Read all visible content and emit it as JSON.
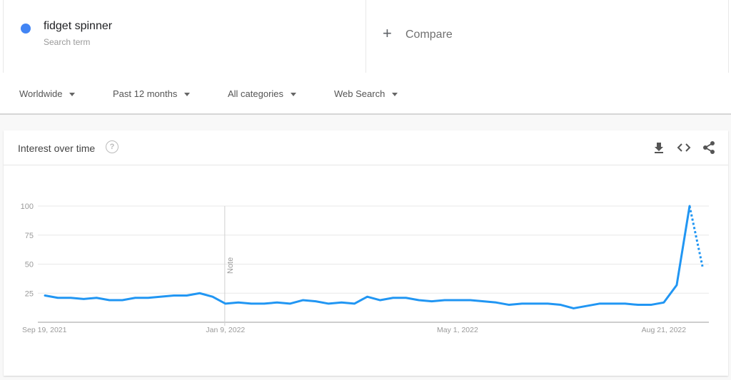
{
  "search_term": {
    "label": "fidget spinner",
    "sublabel": "Search term",
    "color": "#4285f4"
  },
  "compare": {
    "label": "Compare",
    "icon": "plus-icon"
  },
  "filters": [
    {
      "label": "Worldwide"
    },
    {
      "label": "Past 12 months"
    },
    {
      "label": "All categories"
    },
    {
      "label": "Web Search"
    }
  ],
  "card": {
    "title": "Interest over time",
    "help_icon": "?",
    "actions": [
      "download-icon",
      "embed-icon",
      "share-icon"
    ]
  },
  "chart_data": {
    "type": "line",
    "title": "Interest over time",
    "xlabel": "",
    "ylabel": "",
    "ylim": [
      0,
      100
    ],
    "yticks": [
      25,
      50,
      75,
      100
    ],
    "xtick_labels": [
      {
        "label": "Sep 19, 2021",
        "index": 0
      },
      {
        "label": "Jan 9, 2022",
        "index": 14
      },
      {
        "label": "May 1, 2022",
        "index": 32
      },
      {
        "label": "Aug 21, 2022",
        "index": 48
      }
    ],
    "annotation": {
      "label": "Note",
      "index": 14
    },
    "grid": true,
    "line_color": "#2196f3",
    "series": [
      {
        "name": "fidget spinner",
        "values": [
          23,
          21,
          21,
          20,
          21,
          19,
          19,
          21,
          21,
          22,
          23,
          23,
          25,
          22,
          16,
          17,
          16,
          16,
          17,
          16,
          19,
          18,
          16,
          17,
          16,
          22,
          19,
          21,
          21,
          19,
          18,
          19,
          19,
          19,
          18,
          17,
          15,
          16,
          16,
          16,
          15,
          12,
          14,
          16,
          16,
          16,
          15,
          15,
          17,
          32,
          100,
          48
        ],
        "partial_from_index": 50
      }
    ]
  }
}
